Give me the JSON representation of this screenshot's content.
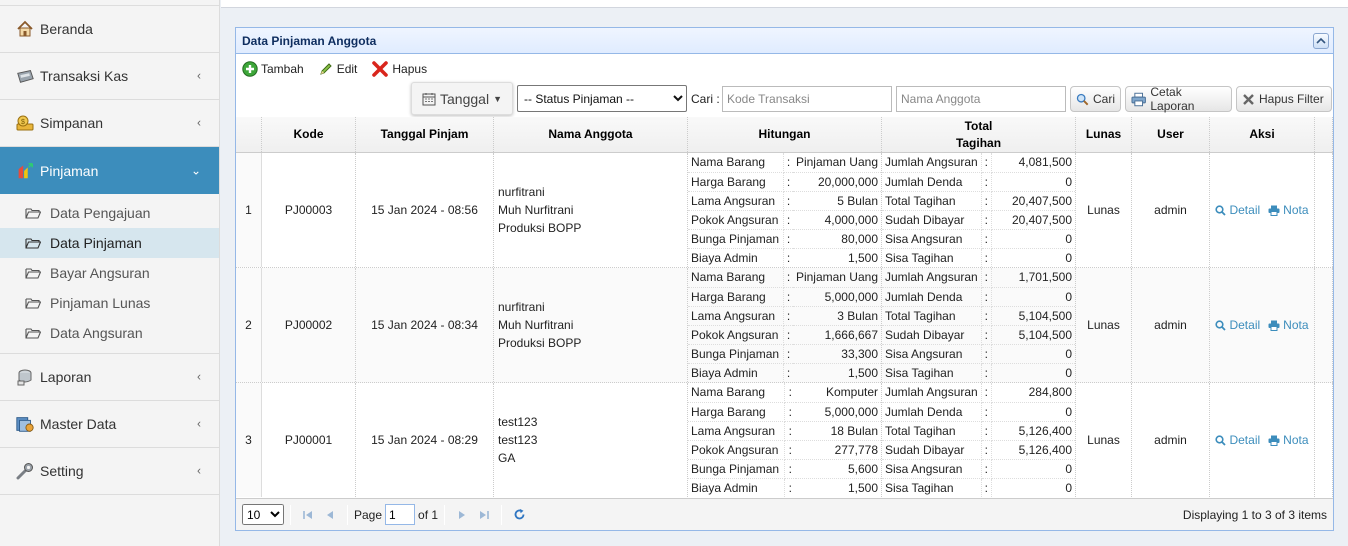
{
  "sidebar": {
    "items": [
      {
        "label": "Beranda",
        "icon": "home-icon"
      },
      {
        "label": "Transaksi Kas",
        "icon": "cash-register-icon"
      },
      {
        "label": "Simpanan",
        "icon": "money-bag-icon"
      },
      {
        "label": "Pinjaman",
        "icon": "money-hand-icon"
      },
      {
        "label": "Laporan",
        "icon": "report-icon"
      },
      {
        "label": "Master Data",
        "icon": "database-icon"
      },
      {
        "label": "Setting",
        "icon": "wrench-icon"
      }
    ],
    "pinjaman_sub": [
      {
        "label": "Data Pengajuan"
      },
      {
        "label": "Data Pinjaman"
      },
      {
        "label": "Bayar Angsuran"
      },
      {
        "label": "Pinjaman Lunas"
      },
      {
        "label": "Data Angsuran"
      }
    ],
    "active_color": "#3c8dbc"
  },
  "panel": {
    "title": "Data Pinjaman Anggota"
  },
  "toolbar": {
    "tambah": "Tambah",
    "edit": "Edit",
    "hapus": "Hapus"
  },
  "filters": {
    "tanggal": "Tanggal",
    "status_selected": "-- Status Pinjaman --",
    "cari_label": "Cari :",
    "kode_placeholder": "Kode Transaksi",
    "nama_placeholder": "Nama Anggota",
    "cari_btn": "Cari",
    "cetak_btn": "Cetak Laporan",
    "hapus_filter_btn": "Hapus Filter"
  },
  "table": {
    "headers": {
      "kode": "Kode",
      "tanggal": "Tanggal Pinjam",
      "nama": "Nama Anggota",
      "hitungan": "Hitungan",
      "total_1": "Total",
      "total_2": "Tagihan",
      "lunas": "Lunas",
      "user": "User",
      "aksi": "Aksi"
    },
    "rows": [
      {
        "no": "1",
        "kode": "PJ00003",
        "tanggal": "15 Jan 2024 - 08:56",
        "nama": [
          "nurfitrani",
          "Muh Nurfitrani",
          "Produksi BOPP"
        ],
        "hitungan": [
          {
            "label": "Nama Barang",
            "sep": ":",
            "value": "Pinjaman Uang"
          },
          {
            "label": "Harga Barang",
            "sep": ":",
            "value": "20,000,000"
          },
          {
            "label": "Lama Angsuran",
            "sep": ":",
            "value": "5 Bulan"
          },
          {
            "label": "Pokok Angsuran",
            "sep": ":",
            "value": "4,000,000"
          },
          {
            "label": "Bunga Pinjaman",
            "sep": ":",
            "value": "80,000"
          },
          {
            "label": "Biaya Admin",
            "sep": ":",
            "value": "1,500"
          }
        ],
        "tagihan": [
          {
            "label": "Jumlah Angsuran",
            "sep": ":",
            "value": "4,081,500"
          },
          {
            "label": "Jumlah Denda",
            "sep": ":",
            "value": "0"
          },
          {
            "label": "Total Tagihan",
            "sep": ":",
            "value": "20,407,500"
          },
          {
            "label": "Sudah Dibayar",
            "sep": ":",
            "value": "20,407,500"
          },
          {
            "label": "Sisa Angsuran",
            "sep": ":",
            "value": "0"
          },
          {
            "label": "Sisa Tagihan",
            "sep": ":",
            "value": "0"
          }
        ],
        "lunas": "Lunas",
        "user": "admin",
        "detail": "Detail",
        "nota": "Nota"
      },
      {
        "no": "2",
        "kode": "PJ00002",
        "tanggal": "15 Jan 2024 - 08:34",
        "nama": [
          "nurfitrani",
          "Muh Nurfitrani",
          "Produksi BOPP"
        ],
        "hitungan": [
          {
            "label": "Nama Barang",
            "sep": ":",
            "value": "Pinjaman Uang"
          },
          {
            "label": "Harga Barang",
            "sep": ":",
            "value": "5,000,000"
          },
          {
            "label": "Lama Angsuran",
            "sep": ":",
            "value": "3 Bulan"
          },
          {
            "label": "Pokok Angsuran",
            "sep": ":",
            "value": "1,666,667"
          },
          {
            "label": "Bunga Pinjaman",
            "sep": ":",
            "value": "33,300"
          },
          {
            "label": "Biaya Admin",
            "sep": ":",
            "value": "1,500"
          }
        ],
        "tagihan": [
          {
            "label": "Jumlah Angsuran",
            "sep": ":",
            "value": "1,701,500"
          },
          {
            "label": "Jumlah Denda",
            "sep": ":",
            "value": "0"
          },
          {
            "label": "Total Tagihan",
            "sep": ":",
            "value": "5,104,500"
          },
          {
            "label": "Sudah Dibayar",
            "sep": ":",
            "value": "5,104,500"
          },
          {
            "label": "Sisa Angsuran",
            "sep": ":",
            "value": "0"
          },
          {
            "label": "Sisa Tagihan",
            "sep": ":",
            "value": "0"
          }
        ],
        "lunas": "Lunas",
        "user": "admin",
        "detail": "Detail",
        "nota": "Nota"
      },
      {
        "no": "3",
        "kode": "PJ00001",
        "tanggal": "15 Jan 2024 - 08:29",
        "nama": [
          "test123",
          "test123",
          "GA"
        ],
        "hitungan": [
          {
            "label": "Nama Barang",
            "sep": ":",
            "value": "Komputer"
          },
          {
            "label": "Harga Barang",
            "sep": ":",
            "value": "5,000,000"
          },
          {
            "label": "Lama Angsuran",
            "sep": ":",
            "value": "18 Bulan"
          },
          {
            "label": "Pokok Angsuran",
            "sep": ":",
            "value": "277,778"
          },
          {
            "label": "Bunga Pinjaman",
            "sep": ":",
            "value": "5,600"
          },
          {
            "label": "Biaya Admin",
            "sep": ":",
            "value": "1,500"
          }
        ],
        "tagihan": [
          {
            "label": "Jumlah Angsuran",
            "sep": ":",
            "value": "284,800"
          },
          {
            "label": "Jumlah Denda",
            "sep": ":",
            "value": "0"
          },
          {
            "label": "Total Tagihan",
            "sep": ":",
            "value": "5,126,400"
          },
          {
            "label": "Sudah Dibayar",
            "sep": ":",
            "value": "5,126,400"
          },
          {
            "label": "Sisa Angsuran",
            "sep": ":",
            "value": "0"
          },
          {
            "label": "Sisa Tagihan",
            "sep": ":",
            "value": "0"
          }
        ],
        "lunas": "Lunas",
        "user": "admin",
        "detail": "Detail",
        "nota": "Nota"
      }
    ]
  },
  "pager": {
    "page_size": "10",
    "page_label": "Page",
    "page_value": "1",
    "of_label": "of 1",
    "info": "Displaying 1 to 3 of 3 items"
  }
}
